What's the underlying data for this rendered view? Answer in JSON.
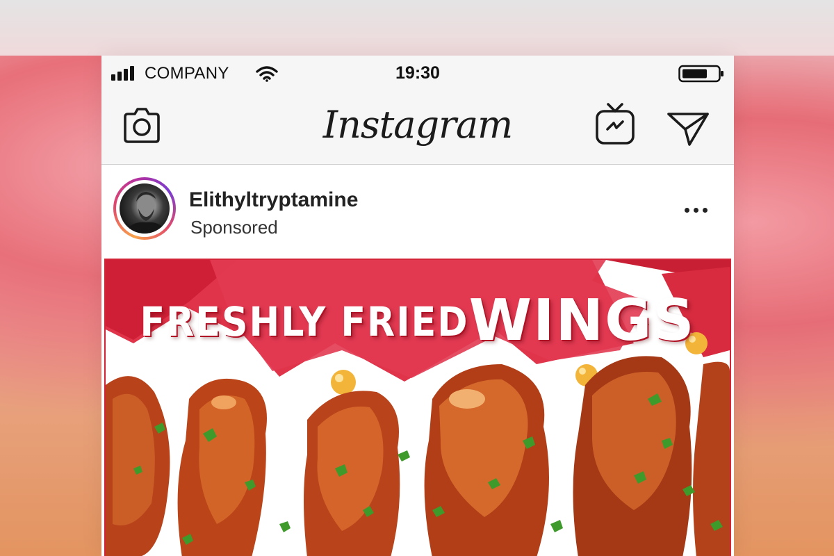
{
  "status_bar": {
    "carrier": "COMPANY",
    "time": "19:30",
    "battery_level": 0.7
  },
  "nav": {
    "logo": "Instagram",
    "icons": [
      "camera-icon",
      "igtv-icon",
      "direct-message-icon"
    ]
  },
  "post": {
    "username": "Elithyltryptamine",
    "label": "Sponsored",
    "ad_text_line1": "FRESHLY FRIED",
    "ad_text_line2": "WINGS"
  },
  "colors": {
    "brand_red": "#d32336",
    "sauce": "#f3b43a",
    "parsley": "#3f9a2c",
    "wing": "#c8431a"
  }
}
